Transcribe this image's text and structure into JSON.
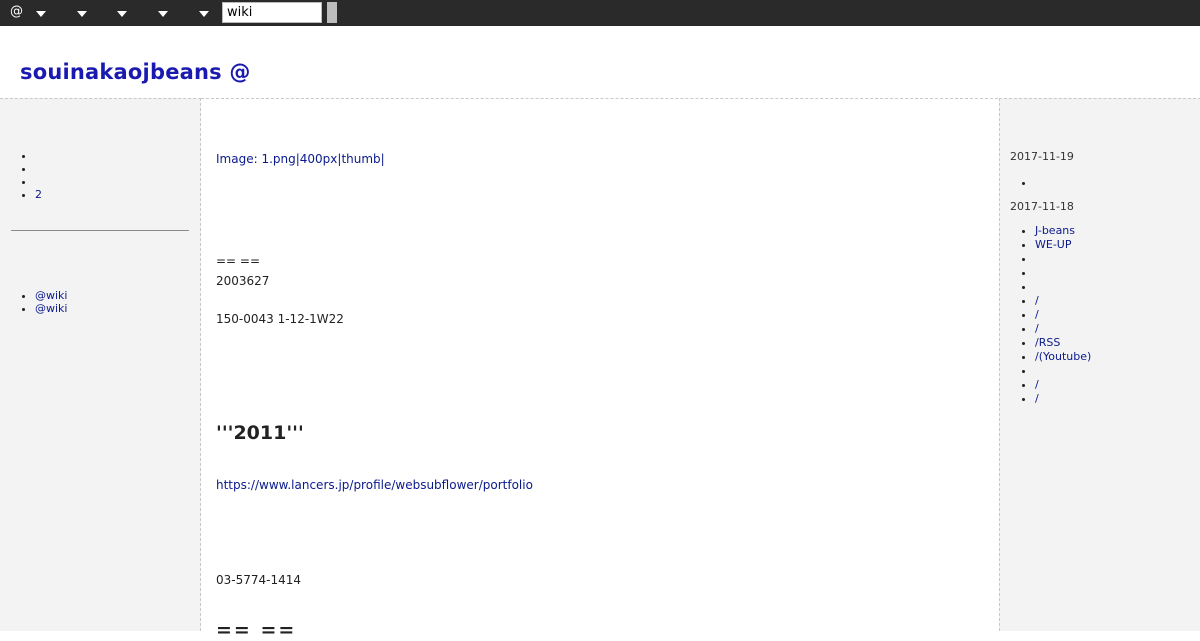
{
  "toolbar": {
    "at_label": "@",
    "search_value": "wiki"
  },
  "site": {
    "title": "souinakaojbeans @"
  },
  "left_sidebar": {
    "list1": [
      "",
      "",
      "",
      "2"
    ],
    "list2": [
      "@wiki",
      "@wiki"
    ]
  },
  "main": {
    "image_markup": "Image: 1.png|400px|thumb|",
    "divider_markup": "==  ==",
    "line_2003627": "2003627",
    "address": "150-0043 1-12-1W22",
    "heading_2011": "'''2011'''",
    "portfolio_link": "https://www.lancers.jp/profile/websubflower/portfolio",
    "phone": "03-5774-1414",
    "heading_cut": "==  =="
  },
  "right_sidebar": {
    "date1": "2017-11-19",
    "list1": [
      ""
    ],
    "date2": "2017-11-18",
    "list2": [
      "J-beans",
      "WE-UP",
      "",
      "",
      "",
      "/",
      "/",
      "/",
      "/RSS",
      "/(Youtube)",
      "",
      "/",
      "/"
    ]
  }
}
